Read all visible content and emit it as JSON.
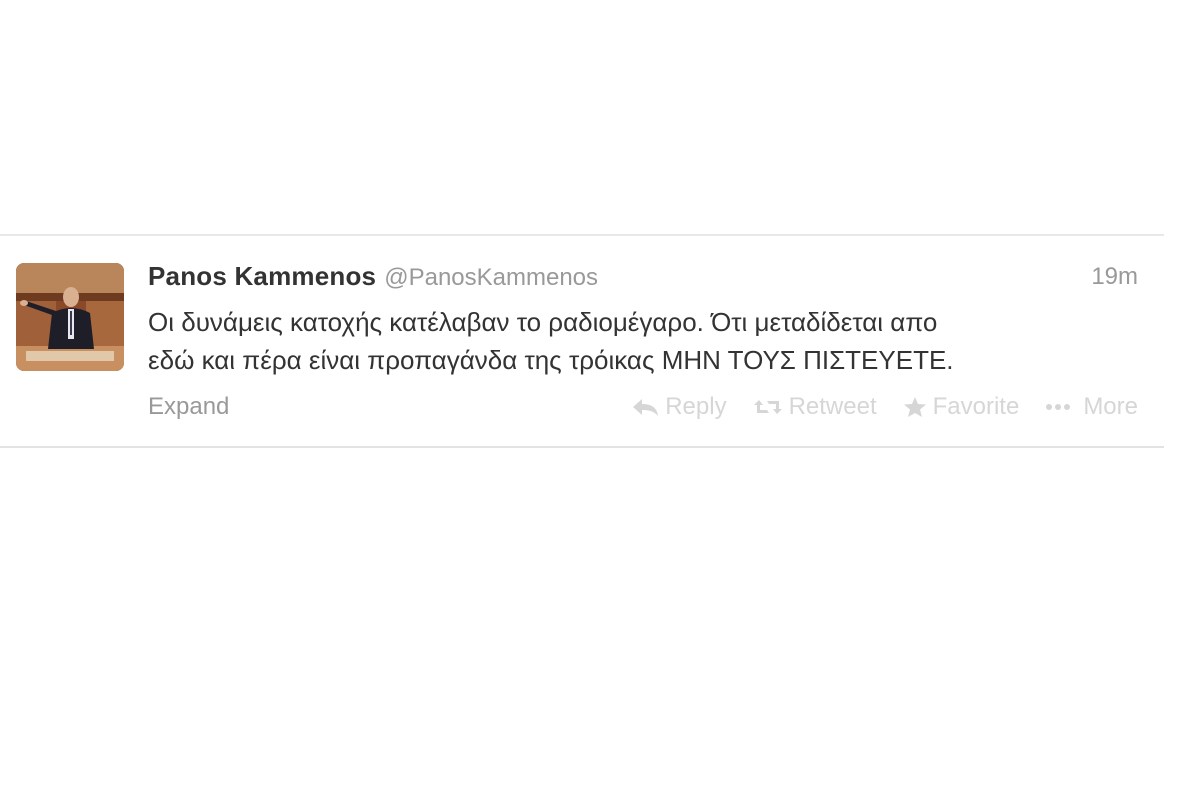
{
  "tweet": {
    "fullname": "Panos Kammenos",
    "username": "@PanosKammenos",
    "timestamp": "19m",
    "text_lines": [
      "Οι δυνάμεις κατοχής κατέλαβαν το ραδιομέγαρο. Ότι μεταδίδεται απο",
      "εδώ και πέρα είναι προπαγάνδα της τρόικας ΜΗΝ ΤΟΥΣ ΠΙΣΤΕΥΕΤΕ."
    ],
    "expand_label": "Expand",
    "actions": {
      "reply": "Reply",
      "retweet": "Retweet",
      "favorite": "Favorite",
      "more": "More"
    }
  },
  "icons": {
    "reply": "reply-arrow-icon",
    "retweet": "retweet-icon",
    "favorite": "star-icon",
    "more": "ellipsis-icon"
  },
  "colors": {
    "name": "#333333",
    "meta": "#999999",
    "actions": "#d6d6d6",
    "divider": "#e8e8e8"
  }
}
